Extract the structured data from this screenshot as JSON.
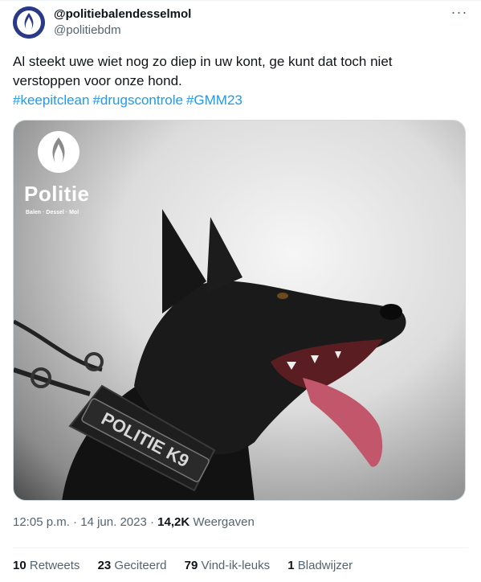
{
  "account": {
    "display_name": "@politiebalendesselmol",
    "handle": "@politiebdm",
    "avatar_icon": "police-flame-logo-icon",
    "avatar_color": "#2b3a86"
  },
  "tweet": {
    "line1": "Al steekt uwe wiet nog zo diep in uw kont, ge kunt dat toch niet",
    "line2": "verstoppen voor onze hond.",
    "hashtags": [
      "#keepitclean",
      "#drugscontrole",
      "#GMM23"
    ],
    "link_color": "#1d9bf0"
  },
  "media": {
    "logo_word": "Politie",
    "logo_sub": "Balen · Dessel · Mol",
    "harness_label": "POLITIE K9"
  },
  "meta": {
    "time": "12:05 p.m.",
    "separator": " · ",
    "date": "14 jun. 2023",
    "views_count": "14,2K",
    "views_label": "Weergaven"
  },
  "stats": [
    {
      "count": "10",
      "label": "Retweets"
    },
    {
      "count": "23",
      "label": "Geciteerd"
    },
    {
      "count": "79",
      "label": "Vind-ik-leuks"
    },
    {
      "count": "1",
      "label": "Bladwijzer"
    }
  ],
  "more_icon": "more-options-icon"
}
